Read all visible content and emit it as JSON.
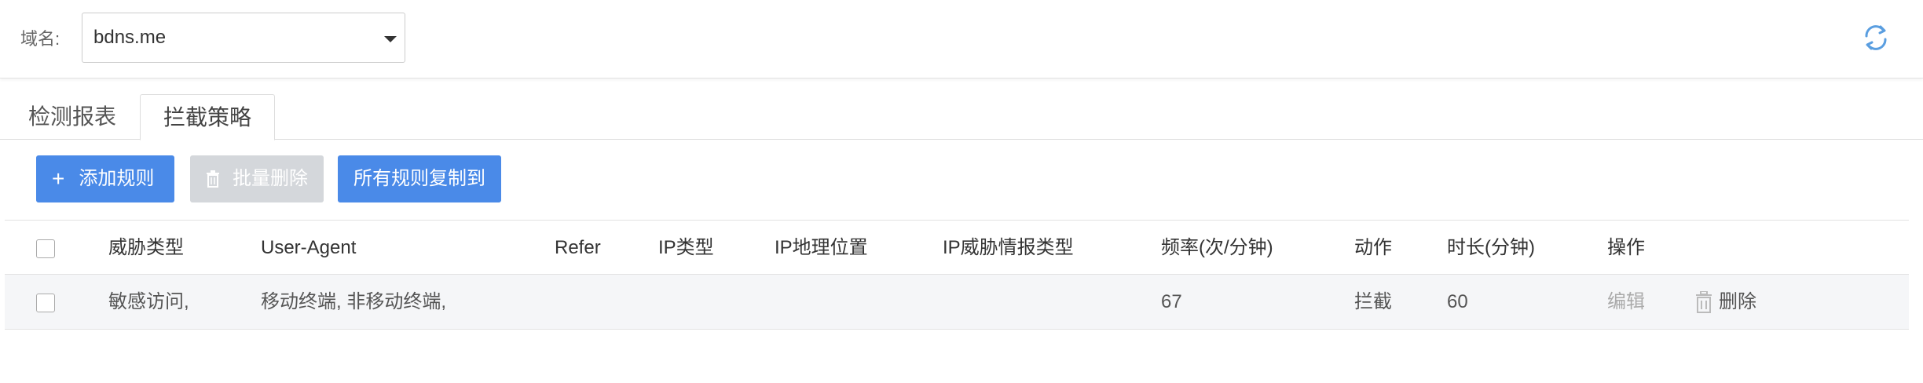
{
  "filter": {
    "domain_label": "域名:",
    "domain_value": "bdns.me"
  },
  "tabs": [
    {
      "label": "检测报表"
    },
    {
      "label": "拦截策略"
    }
  ],
  "toolbar": {
    "add_label": "添加规则",
    "batch_delete_label": "批量删除",
    "copy_all_label": "所有规则复制到"
  },
  "table": {
    "headers": {
      "threat_type": "威胁类型",
      "user_agent": "User-Agent",
      "refer": "Refer",
      "ip_type": "IP类型",
      "ip_geo": "IP地理位置",
      "ip_intel": "IP威胁情报类型",
      "frequency": "频率(次/分钟)",
      "action": "动作",
      "duration": "时长(分钟)",
      "operations": "操作"
    },
    "rows": [
      {
        "threat_type": "敏感访问,",
        "user_agent": "移动终端, 非移动终端,",
        "refer": "",
        "ip_type": "",
        "ip_geo": "",
        "ip_intel": "",
        "frequency": "67",
        "action": "拦截",
        "duration": "60",
        "edit_label": "编辑",
        "delete_label": "删除"
      }
    ]
  },
  "icons": {
    "refresh": "refresh-icon",
    "plus": "plus-icon",
    "trash": "trash-icon",
    "caret": "chevron-down-icon"
  },
  "colors": {
    "primary": "#4a8ae8",
    "disabled": "#d4d7db",
    "row_bg": "#f5f6f8"
  }
}
